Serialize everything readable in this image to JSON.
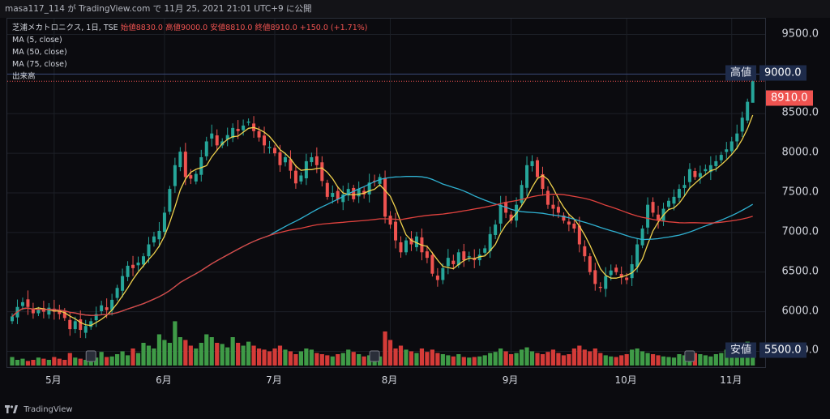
{
  "header": {
    "text": "masa117_114 が TradingView.com で 11月 25, 2021 21:01 UTC+9 に公開"
  },
  "legend": {
    "symbol": "芝浦メカトロニクス, 1日, TSE",
    "ohlc": "始値8830.0 高値9000.0 安値8810.0 終値8910.0 +150.0 (+1.71%)",
    "ma5": "MA (5, close)",
    "ma50": "MA (50, close)",
    "ma75": "MA (75, close)",
    "volume": "出来高"
  },
  "price_labels": {
    "high_tag": "高値",
    "high_value": "9000.0",
    "last_value": "8910.0",
    "low_tag": "安値",
    "low_value": "5500.0"
  },
  "footer": {
    "brand": "TradingView"
  },
  "colors": {
    "up": "#26a69a",
    "down": "#ef5350",
    "ma5": "#f0d24d",
    "ma50": "#2fb1d1",
    "ma75": "#e0423e",
    "vol_up": "#3f9b47",
    "vol_down": "#d43b38",
    "bg": "#0b0b0f"
  },
  "chart_data": {
    "type": "candlestick",
    "title": "芝浦メカトロニクス, 1日, TSE",
    "y_ticks": [
      "9500.0",
      "8500.0",
      "8000.0",
      "7500.0",
      "7000.0",
      "6500.0",
      "6000.0",
      "5500.0"
    ],
    "y_tick_values": [
      9500,
      8500,
      8000,
      7500,
      7000,
      6500,
      6000,
      5500
    ],
    "ylim": [
      5300,
      9700
    ],
    "x_ticks": [
      "5月",
      "6月",
      "7月",
      "8月",
      "9月",
      "10月",
      "11月"
    ],
    "x_tick_index": [
      8,
      29,
      50,
      72,
      95,
      117,
      137
    ],
    "last_close": 8910,
    "day_high": 9000,
    "day_low": 8810,
    "grid": true,
    "series": [
      {
        "name": "MA (5, close)",
        "key": "ma5"
      },
      {
        "name": "MA (50, close)",
        "key": "ma50"
      },
      {
        "name": "MA (75, close)",
        "key": "ma75"
      },
      {
        "name": "出来高",
        "key": "volume"
      }
    ],
    "close": [
      5940,
      6060,
      6120,
      6060,
      5980,
      6020,
      6000,
      6050,
      6000,
      5970,
      5920,
      5780,
      5880,
      5770,
      5820,
      5880,
      5970,
      6080,
      6020,
      6150,
      6300,
      6450,
      6580,
      6550,
      6620,
      6700,
      6850,
      6950,
      7020,
      7250,
      7550,
      7850,
      8020,
      7700,
      7680,
      7740,
      7950,
      8150,
      8250,
      8100,
      8150,
      8230,
      8320,
      8280,
      8350,
      8400,
      8280,
      8200,
      8100,
      8080,
      8000,
      7850,
      7950,
      7780,
      7620,
      7720,
      7900,
      7950,
      7850,
      7650,
      7450,
      7500,
      7420,
      7480,
      7550,
      7420,
      7550,
      7480,
      7630,
      7650,
      7700,
      7200,
      7100,
      6900,
      6750,
      6900,
      6850,
      6950,
      6750,
      6680,
      6480,
      6400,
      6550,
      6680,
      6600,
      6750,
      6650,
      6700,
      6650,
      6720,
      6800,
      6980,
      7100,
      7350,
      7250,
      7150,
      7350,
      7600,
      7850,
      7900,
      7700,
      7550,
      7350,
      7300,
      7250,
      7150,
      7100,
      7050,
      6850,
      6700,
      6500,
      6350,
      6300,
      6450,
      6520,
      6500,
      6430,
      6400,
      6600,
      6850,
      7050,
      7350,
      7250,
      7150,
      7300,
      7400,
      7450,
      7550,
      7600,
      7800,
      7700,
      7750,
      7800,
      7850,
      7900,
      7980,
      8050,
      8150,
      8250,
      8450,
      8650,
      8910
    ],
    "volume": [
      0.15,
      0.1,
      0.12,
      0.08,
      0.1,
      0.14,
      0.12,
      0.1,
      0.15,
      0.12,
      0.1,
      0.22,
      0.14,
      0.12,
      0.1,
      0.12,
      0.14,
      0.24,
      0.15,
      0.16,
      0.2,
      0.25,
      0.18,
      0.3,
      0.22,
      0.4,
      0.35,
      0.3,
      0.55,
      0.45,
      0.4,
      0.78,
      0.5,
      0.45,
      0.35,
      0.3,
      0.4,
      0.55,
      0.5,
      0.4,
      0.38,
      0.32,
      0.5,
      0.4,
      0.35,
      0.42,
      0.35,
      0.3,
      0.28,
      0.25,
      0.3,
      0.35,
      0.28,
      0.25,
      0.2,
      0.25,
      0.3,
      0.28,
      0.22,
      0.2,
      0.18,
      0.16,
      0.2,
      0.22,
      0.28,
      0.24,
      0.2,
      0.16,
      0.18,
      0.15,
      0.16,
      0.6,
      0.45,
      0.3,
      0.35,
      0.28,
      0.25,
      0.22,
      0.3,
      0.24,
      0.28,
      0.22,
      0.2,
      0.18,
      0.16,
      0.2,
      0.15,
      0.14,
      0.15,
      0.16,
      0.18,
      0.22,
      0.24,
      0.3,
      0.25,
      0.2,
      0.22,
      0.28,
      0.32,
      0.25,
      0.22,
      0.2,
      0.24,
      0.28,
      0.22,
      0.18,
      0.2,
      0.3,
      0.35,
      0.28,
      0.25,
      0.3,
      0.22,
      0.18,
      0.16,
      0.15,
      0.18,
      0.2,
      0.28,
      0.3,
      0.25,
      0.22,
      0.2,
      0.18,
      0.16,
      0.15,
      0.14,
      0.2,
      0.18,
      0.16,
      0.22,
      0.2,
      0.18,
      0.16,
      0.2,
      0.22,
      0.28,
      0.3,
      0.26,
      0.38,
      0.42,
      0.28
    ]
  }
}
